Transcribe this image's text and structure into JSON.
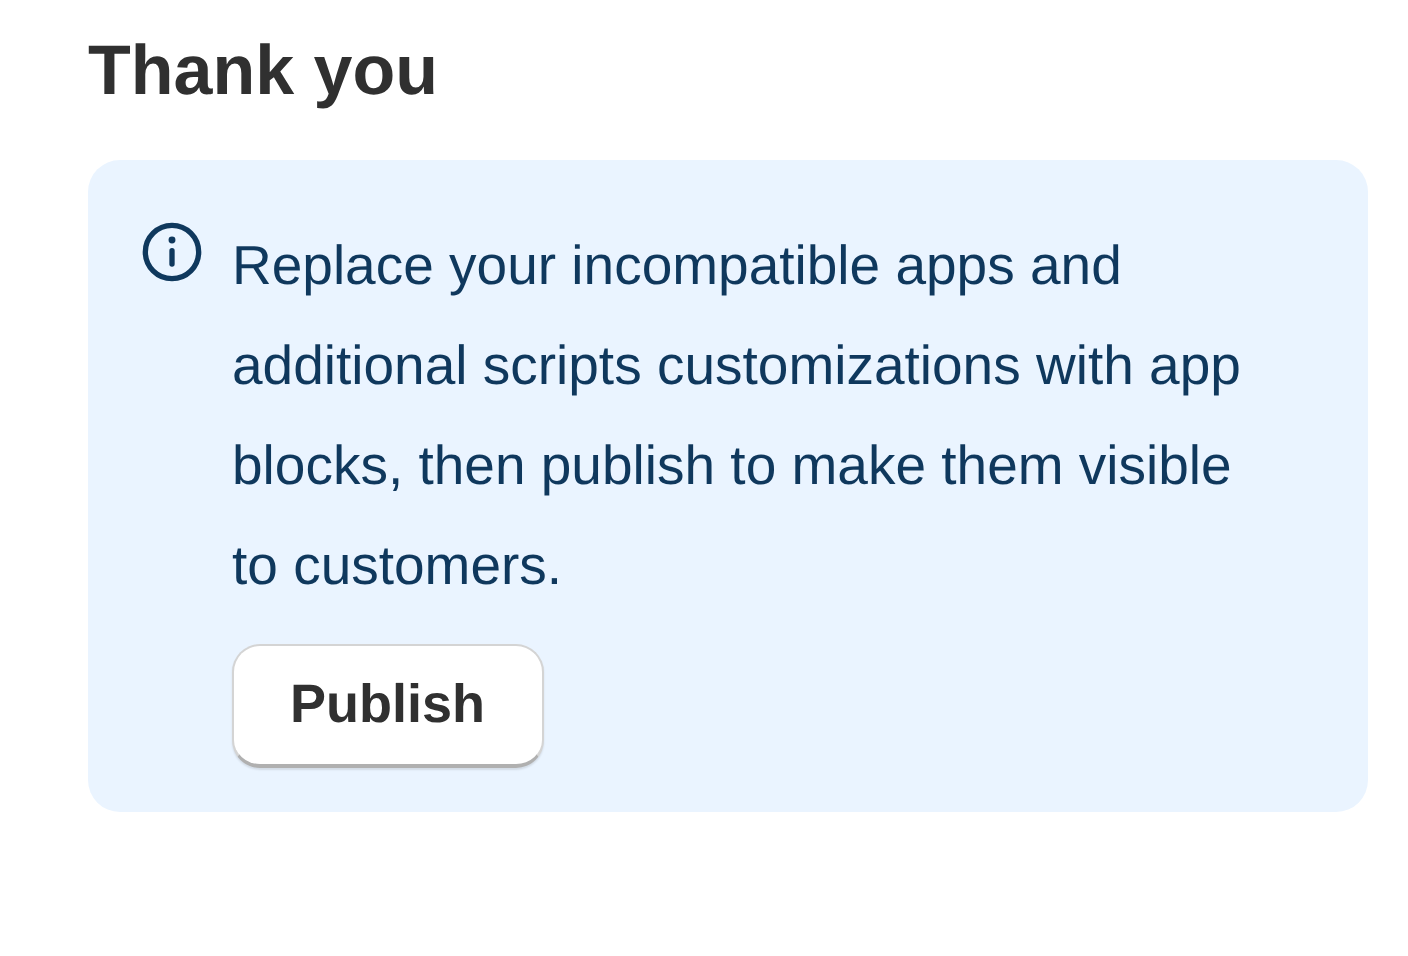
{
  "heading": "Thank you",
  "banner": {
    "kind": "info",
    "message": "Replace your incompatible apps and additional scripts customizations with app blocks, then publish to make them visible to customers.",
    "button": "Publish"
  }
}
